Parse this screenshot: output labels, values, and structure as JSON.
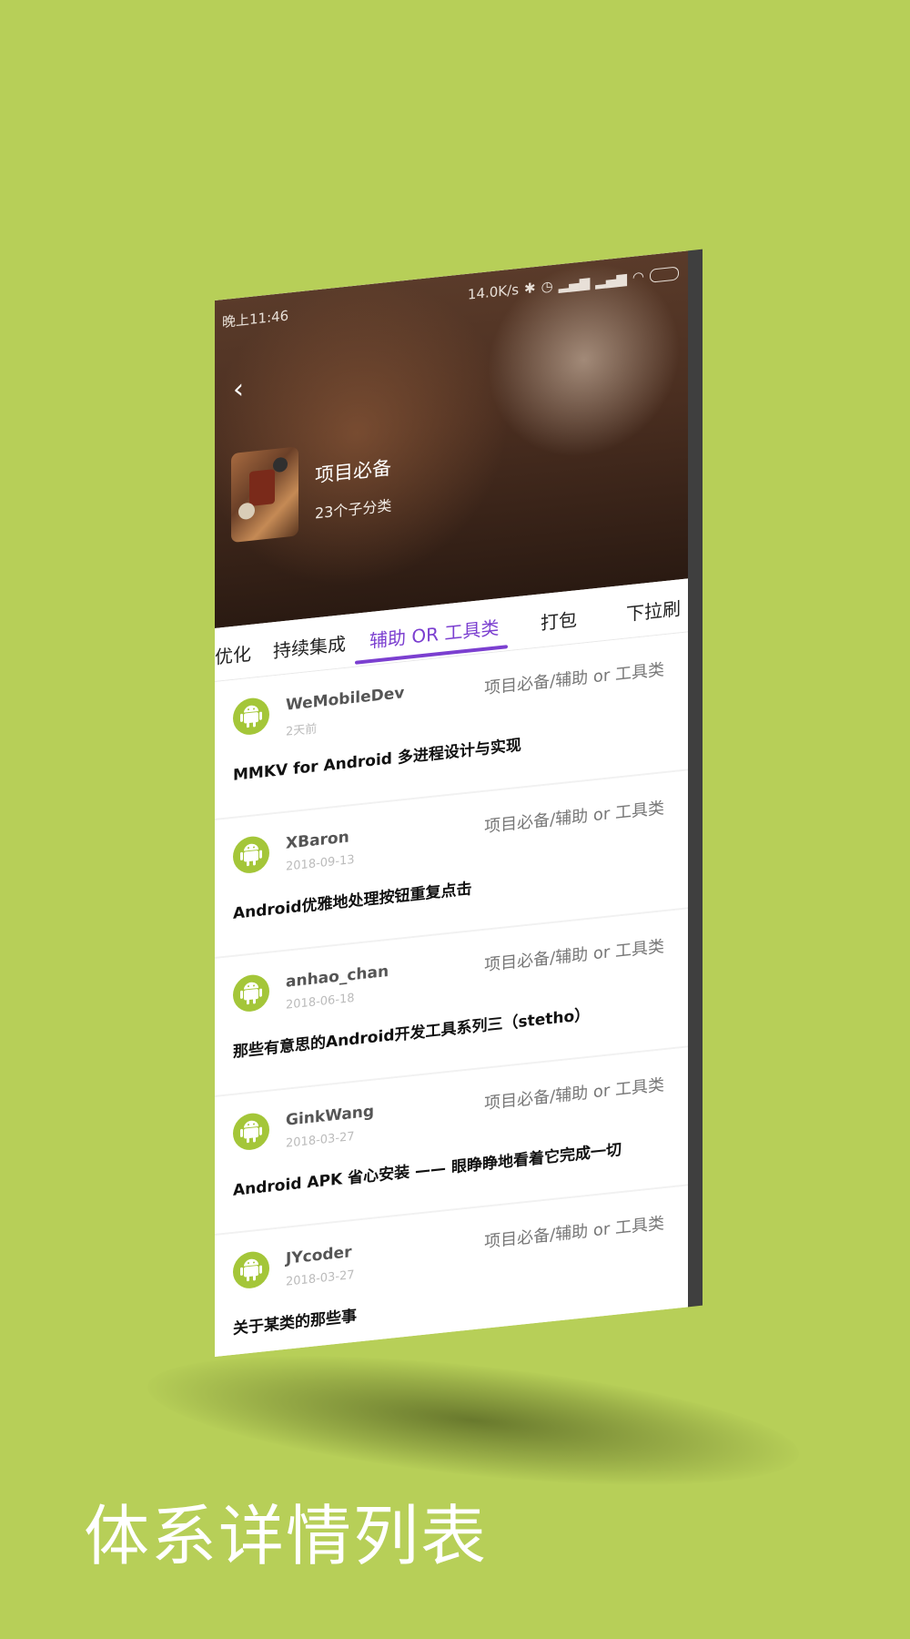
{
  "status_bar": {
    "time": "晚上11:46",
    "speed": "14.0K/s"
  },
  "header": {
    "title": "项目必备",
    "subtitle": "23个子分类"
  },
  "tabs": [
    {
      "label": "优化",
      "active": false
    },
    {
      "label": "持续集成",
      "active": false
    },
    {
      "label": "辅助 OR 工具类",
      "active": true
    },
    {
      "label": "打包",
      "active": false
    },
    {
      "label": "下拉刷",
      "active": false
    }
  ],
  "articles": [
    {
      "author": "WeMobileDev",
      "date": "2天前",
      "category": "项目必备/辅助 or 工具类",
      "title": "MMKV for Android 多进程设计与实现"
    },
    {
      "author": "XBaron",
      "date": "2018-09-13",
      "category": "项目必备/辅助 or 工具类",
      "title": "Android优雅地处理按钮重复点击"
    },
    {
      "author": "anhao_chan",
      "date": "2018-06-18",
      "category": "项目必备/辅助 or 工具类",
      "title": "那些有意思的Android开发工具系列三（stetho）"
    },
    {
      "author": "GinkWang",
      "date": "2018-03-27",
      "category": "项目必备/辅助 or 工具类",
      "title": "Android APK 省心安装 —— 眼睁睁地看着它完成一切"
    },
    {
      "author": "JYcoder",
      "date": "2018-03-27",
      "category": "项目必备/辅助 or 工具类",
      "title": "关于某类的那些事"
    }
  ],
  "slogan": "体系详情列表",
  "colors": {
    "background": "#b7cf58",
    "accent": "#7b3fd0",
    "avatar": "#a4c639"
  }
}
